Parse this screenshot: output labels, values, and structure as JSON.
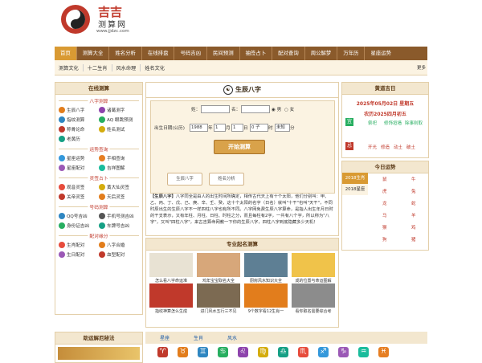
{
  "brand": {
    "name": "吉吉",
    "sub": "测算网",
    "url": "www.jjdzc.com"
  },
  "nav": [
    "首页",
    "测算大全",
    "姓名分析",
    "在线排盘",
    "号码吉凶",
    "民间预测",
    "抽签占卜",
    "配对查询",
    "周公解梦",
    "万年历",
    "星座运势"
  ],
  "subnav": {
    "items": [
      "测算文化",
      "十二生肖",
      "风水命理",
      "姓名文化"
    ],
    "more": "更多"
  },
  "left": {
    "title": "在线测算",
    "sections": [
      {
        "name": "八字测算",
        "items": [
          "生辰八字",
          "诸葛测字",
          "指纹测算",
          "AQ 眼跳预测",
          "称骨论命",
          "姓名测试",
          "老黄历"
        ]
      },
      {
        "name": "运势查询",
        "items": [
          "星座运势",
          "手相查询",
          "星座配对",
          "吉祥图解"
        ]
      },
      {
        "name": "灵签占卜",
        "items": [
          "观音灵签",
          "黄大仙灵签",
          "关帝灵签",
          "天后灵签"
        ]
      },
      {
        "name": "号码测算",
        "items": [
          "QQ号吉凶",
          "手机号测吉凶",
          "身份证吉凶",
          "车牌号吉凶"
        ]
      },
      {
        "name": "配对缘分",
        "items": [
          "生肖配对",
          "八字合婚",
          "生日配对",
          "血型配对"
        ]
      }
    ]
  },
  "center": {
    "title": "生辰八字",
    "form": {
      "surname_label": "姓：",
      "name_label": "名：",
      "male": "男",
      "female": "女",
      "birth_label": "出生日期(公历)",
      "year": "1988",
      "year_unit": "年",
      "month": "1",
      "month_unit": "月",
      "day": "1",
      "day_unit": "日",
      "hour": "0 子",
      "hour_unit": "时",
      "minute": "未知",
      "minute_unit": "分",
      "submit": "开始测算",
      "btn1": "生辰八字",
      "btn2": "姓名分析"
    },
    "intro_bold": "【生辰八字】",
    "intro": "八字同全是由人的出生时间所确定，相传古代天上有十个太阳，他们分别叫：甲、乙、丙、丁、戊、己、庚、辛、壬、癸，这十个太阳的名字（日名）就叫\"十干\"也叫\"天干\"，不同时辰出生的生辰八字不一样四柱八字也有所不同。八字网免费生辰八字算命，是指人出生年月日时的干支表示，又有年柱、月柱、日柱、时柱之分，而且每柱有2字，一共有八个字，所以称为\"八字\"，又叫\"四柱八字\"，来古吉算命网教一下你的生辰八字，四柱八字到底隐藏多少天机！",
    "section2": "专业起名测算",
    "thumbs": [
      "怎么看八字命运准",
      "鸡年宝宝取名大全",
      "厨房风水知识大全",
      "成的位置与命运图解",
      "指纹神算怎么生成",
      "进门风水五行三不见",
      "9个数字看12生肖一",
      "看你取名需要综合考"
    ]
  },
  "right": {
    "title": "黄道吉日",
    "date": "2025年05月02日 星期五",
    "lunar": "农历2025四月初五",
    "good": [
      "祭祀",
      "修饰垣墙",
      "除事则取"
    ],
    "bad": [
      "开光",
      "修造",
      "动土",
      "破土"
    ],
    "title2": "今日运势",
    "years": [
      "2018生肖",
      "2018星座"
    ],
    "animals": [
      "鼠",
      "牛",
      "虎",
      "兔",
      "龙",
      "蛇",
      "马",
      "羊",
      "猴",
      "鸡",
      "狗",
      "猪"
    ]
  },
  "bottom": {
    "left_title": "助运解厄秘法",
    "tabs": [
      "星座",
      "生肖",
      "风水"
    ]
  },
  "colors": {
    "nav": "#8a5a2b",
    "active": "#d99a33",
    "accent": "#c0392b",
    "zodiac": [
      "#c0392b",
      "#e27d1c",
      "#2e86c1",
      "#27ae60",
      "#8e44ad",
      "#d4ac0d",
      "#16a085",
      "#e74c3c",
      "#3498db",
      "#9b59b6",
      "#1abc9c",
      "#e67e22"
    ]
  }
}
